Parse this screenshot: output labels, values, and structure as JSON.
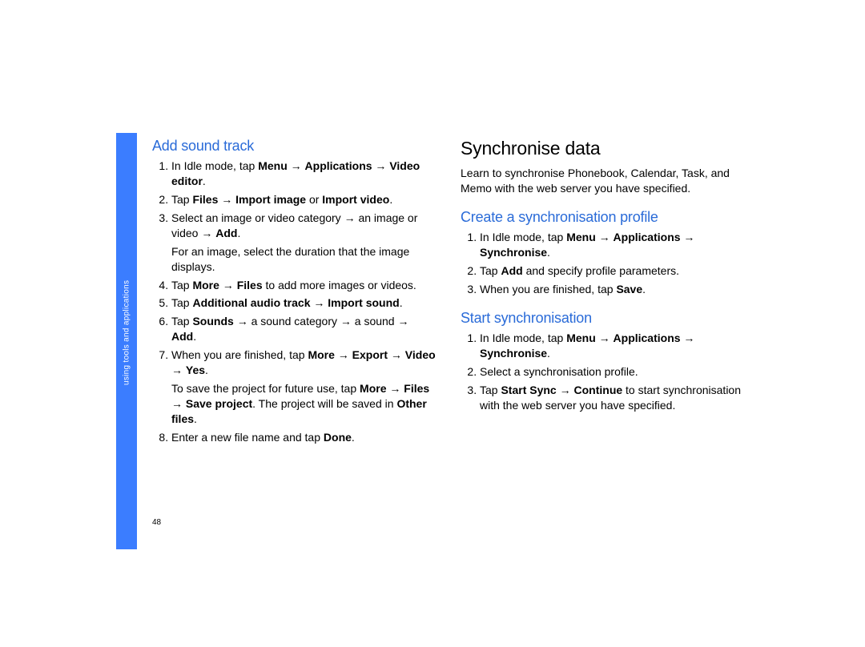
{
  "sidebar": {
    "label": "using tools and applications"
  },
  "page_number": "48",
  "left": {
    "heading": "Add sound track",
    "items": [
      {
        "html": "In Idle mode, tap <b>Menu</b> → <b>Applications</b> → <b>Video editor</b>."
      },
      {
        "html": "Tap <b>Files</b> → <b>Import image</b> or <b>Import video</b>."
      },
      {
        "html": "Select an image or video category → an image or video → <b>Add</b>.",
        "cont": "For an image, select the duration that the image displays."
      },
      {
        "html": "Tap <b>More</b> → <b>Files</b> to add more images or videos."
      },
      {
        "html": "Tap <b>Additional audio track</b> → <b>Import sound</b>."
      },
      {
        "html": "Tap <b>Sounds</b> → a sound category → a sound → <b>Add</b>."
      },
      {
        "html": "When you are finished, tap <b>More</b> → <b>Export</b> → <b>Video</b> → <b>Yes</b>.",
        "cont": "To save the project for future use, tap <b>More</b> → <b>Files</b> → <b>Save project</b>. The project will be saved in <b>Other files</b>."
      },
      {
        "html": "Enter a new file name and tap <b>Done</b>."
      }
    ]
  },
  "right": {
    "title": "Synchronise data",
    "intro": "Learn to synchronise Phonebook, Calendar, Task, and Memo with the web server you have specified.",
    "section1": {
      "heading": "Create a synchronisation profile",
      "items": [
        {
          "html": "In Idle mode, tap <b>Menu</b> → <b>Applications</b> → <b>Synchronise</b>."
        },
        {
          "html": "Tap <b>Add</b> and specify profile parameters."
        },
        {
          "html": "When you are finished, tap <b>Save</b>."
        }
      ]
    },
    "section2": {
      "heading": "Start synchronisation",
      "items": [
        {
          "html": "In Idle mode, tap <b>Menu</b> → <b>Applications</b> → <b>Synchronise</b>."
        },
        {
          "html": "Select a synchronisation profile."
        },
        {
          "html": "Tap <b>Start Sync</b> → <b>Continue</b> to start synchronisation with the web server you have specified."
        }
      ]
    }
  }
}
